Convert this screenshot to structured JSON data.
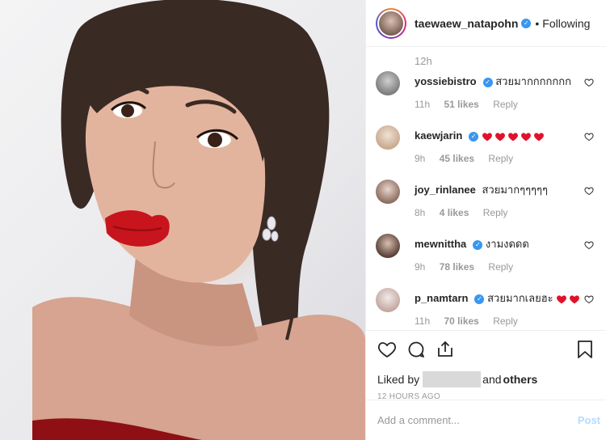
{
  "post": {
    "author": "taewaew_natapohn",
    "follow_dot": "•",
    "follow_status": "Following",
    "time_first": "12h",
    "like_label": "Like"
  },
  "comments": [
    {
      "user": "yossiebistro",
      "verified": true,
      "text": "สวยมากกกกกกก",
      "time": "11h",
      "likes": "51 likes",
      "reply": "Reply",
      "hearts": 0
    },
    {
      "user": "kaewjarin",
      "verified": true,
      "text": "",
      "time": "9h",
      "likes": "45 likes",
      "reply": "Reply",
      "hearts": 5
    },
    {
      "user": "joy_rinlanee",
      "verified": false,
      "text": "สวยมากๆๆๆๆๆ",
      "time": "8h",
      "likes": "4 likes",
      "reply": "Reply",
      "hearts": 0
    },
    {
      "user": "mewnittha",
      "verified": true,
      "text": "งามงดดด",
      "time": "9h",
      "likes": "78 likes",
      "reply": "Reply",
      "hearts": 0
    },
    {
      "user": "p_namtarn",
      "verified": true,
      "text": "สวยมากเลยฮะ",
      "time": "11h",
      "likes": "70 likes",
      "reply": "Reply",
      "hearts": 2
    }
  ],
  "engagement": {
    "liked_by_prefix": "Liked by",
    "and_text": "and",
    "others": "others",
    "posted_ago": "12 HOURS AGO"
  },
  "composer": {
    "placeholder": "Add a comment...",
    "post_label": "Post"
  },
  "colors": {
    "verified_blue": "#3897f0",
    "heart_red": "#ed4956",
    "lip_red": "#c8141c"
  },
  "icons": [
    "heart-icon",
    "comment-icon",
    "share-icon",
    "bookmark-icon",
    "verified-icon"
  ]
}
